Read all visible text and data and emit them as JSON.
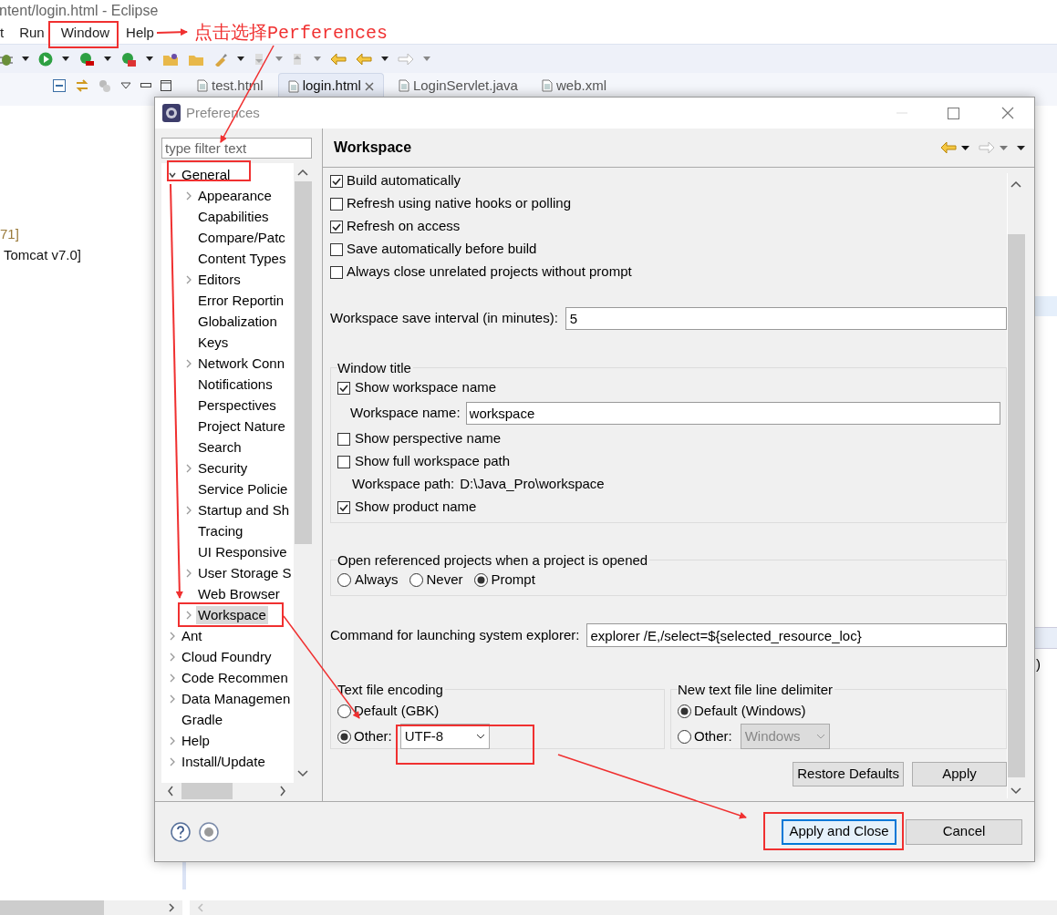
{
  "ide": {
    "title": "ntent/login.html - Eclipse",
    "menu": [
      "t",
      "Run",
      "Window",
      "Help"
    ],
    "editor_tabs": [
      {
        "label": "test.html",
        "selected": false
      },
      {
        "label": "login.html",
        "selected": true
      },
      {
        "label": "LoginServlet.java",
        "selected": false
      },
      {
        "label": "web.xml",
        "selected": false
      }
    ],
    "editor_fragment": ")",
    "console_lines": [
      {
        "text": "71]",
        "kind": "muted"
      },
      {
        "text": "Tomcat v7.0]",
        "kind": "plain"
      }
    ]
  },
  "annotation": {
    "text": "点击选择Perferences"
  },
  "dialog": {
    "title": "Preferences",
    "filter": {
      "placeholder": "type filter text"
    },
    "tree": [
      {
        "label": "General",
        "expandable": true,
        "expanded": true,
        "selected": false,
        "children": [
          {
            "label": "Appearance",
            "expandable": true,
            "selected": false
          },
          {
            "label": "Capabilities",
            "expandable": false,
            "selected": false
          },
          {
            "label": "Compare/Patc",
            "expandable": false,
            "selected": false
          },
          {
            "label": "Content Types",
            "expandable": false,
            "selected": false
          },
          {
            "label": "Editors",
            "expandable": true,
            "selected": false
          },
          {
            "label": "Error Reportin",
            "expandable": false,
            "selected": false
          },
          {
            "label": "Globalization",
            "expandable": false,
            "selected": false
          },
          {
            "label": "Keys",
            "expandable": false,
            "selected": false
          },
          {
            "label": "Network Conn",
            "expandable": true,
            "selected": false
          },
          {
            "label": "Notifications",
            "expandable": false,
            "selected": false
          },
          {
            "label": "Perspectives",
            "expandable": false,
            "selected": false
          },
          {
            "label": "Project Nature",
            "expandable": false,
            "selected": false
          },
          {
            "label": "Search",
            "expandable": false,
            "selected": false
          },
          {
            "label": "Security",
            "expandable": true,
            "selected": false
          },
          {
            "label": "Service Policie",
            "expandable": false,
            "selected": false
          },
          {
            "label": "Startup and Sh",
            "expandable": true,
            "selected": false
          },
          {
            "label": "Tracing",
            "expandable": false,
            "selected": false
          },
          {
            "label": "UI Responsive",
            "expandable": false,
            "selected": false
          },
          {
            "label": "User Storage S",
            "expandable": true,
            "selected": false
          },
          {
            "label": "Web Browser",
            "expandable": false,
            "selected": false
          },
          {
            "label": "Workspace",
            "expandable": true,
            "selected": true
          }
        ]
      },
      {
        "label": "Ant",
        "expandable": true,
        "selected": false
      },
      {
        "label": "Cloud Foundry",
        "expandable": true,
        "selected": false
      },
      {
        "label": "Code Recommen",
        "expandable": true,
        "selected": false
      },
      {
        "label": "Data Managemen",
        "expandable": true,
        "selected": false
      },
      {
        "label": "Gradle",
        "expandable": false,
        "selected": false
      },
      {
        "label": "Help",
        "expandable": true,
        "selected": false
      },
      {
        "label": "Install/Update",
        "expandable": true,
        "selected": false
      }
    ],
    "page_title": "Workspace",
    "options": [
      {
        "label": "Build automatically",
        "checked": true
      },
      {
        "label": "Refresh using native hooks or polling",
        "checked": false
      },
      {
        "label": "Refresh on access",
        "checked": true
      },
      {
        "label": "Save automatically before build",
        "checked": false
      },
      {
        "label": "Always close unrelated projects without prompt",
        "checked": false
      }
    ],
    "save_interval": {
      "label": "Workspace save interval (in minutes):",
      "value": "5"
    },
    "window_title": {
      "legend": "Window title",
      "items": [
        {
          "kind": "checkbox",
          "label": "Show workspace name",
          "checked": true
        },
        {
          "kind": "field",
          "label": "Workspace name:",
          "value": "workspace"
        },
        {
          "kind": "checkbox",
          "label": "Show perspective name",
          "checked": false
        },
        {
          "kind": "checkbox",
          "label": "Show full workspace path",
          "checked": false
        },
        {
          "kind": "info",
          "label": "Workspace path:",
          "value": "D:\\Java_Pro\\workspace"
        },
        {
          "kind": "checkbox",
          "label": "Show product name",
          "checked": true
        }
      ]
    },
    "open_referenced": {
      "legend": "Open referenced projects when a project is opened",
      "options": [
        {
          "label": "Always",
          "selected": false
        },
        {
          "label": "Never",
          "selected": false
        },
        {
          "label": "Prompt",
          "selected": true
        }
      ]
    },
    "explorer_command": {
      "label": "Command for launching system explorer:",
      "value": "explorer /E,/select=${selected_resource_loc}"
    },
    "encoding": {
      "legend": "Text file encoding",
      "options": [
        {
          "label": "Default (GBK)",
          "selected": false
        },
        {
          "label": "Other:",
          "selected": true,
          "dropdown": "UTF-8"
        }
      ]
    },
    "line_delimiter": {
      "legend": "New text file line delimiter",
      "options": [
        {
          "label": "Default (Windows)",
          "selected": true
        },
        {
          "label": "Other:",
          "selected": false,
          "dropdown": "Windows"
        }
      ]
    },
    "page_buttons": [
      "Restore Defaults",
      "Apply"
    ],
    "dialog_buttons": [
      {
        "label": "Apply and Close",
        "default": true
      },
      {
        "label": "Cancel",
        "default": false
      }
    ]
  }
}
